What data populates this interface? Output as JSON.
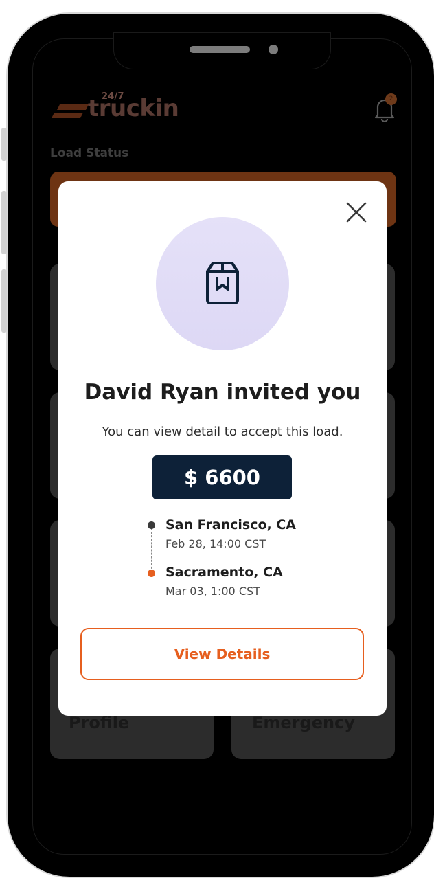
{
  "app": {
    "logo_superscript": "24/7",
    "logo_text": "truckin",
    "notification_count": "2",
    "load_status_label": "Load Status"
  },
  "dashboard": {
    "tiles": [
      {
        "label": "Profile"
      },
      {
        "label": "Emergency"
      }
    ]
  },
  "modal": {
    "title": "David Ryan invited you",
    "subtitle": "You can view detail to accept this load.",
    "price": "$ 6600",
    "origin": {
      "city": "San Francisco, CA",
      "time": "Feb 28, 14:00 CST"
    },
    "destination": {
      "city": "Sacramento, CA",
      "time": "Mar 03, 1:00 CST"
    },
    "cta_label": "View Details"
  },
  "icons": {
    "close": "close-icon",
    "hero": "package-icon",
    "notifications": "bell-icon"
  },
  "colors": {
    "accent": "#e65f1f",
    "price_bg": "#0d2138",
    "origin_dot": "#3a3a3a",
    "destination_dot": "#e65f1f"
  }
}
